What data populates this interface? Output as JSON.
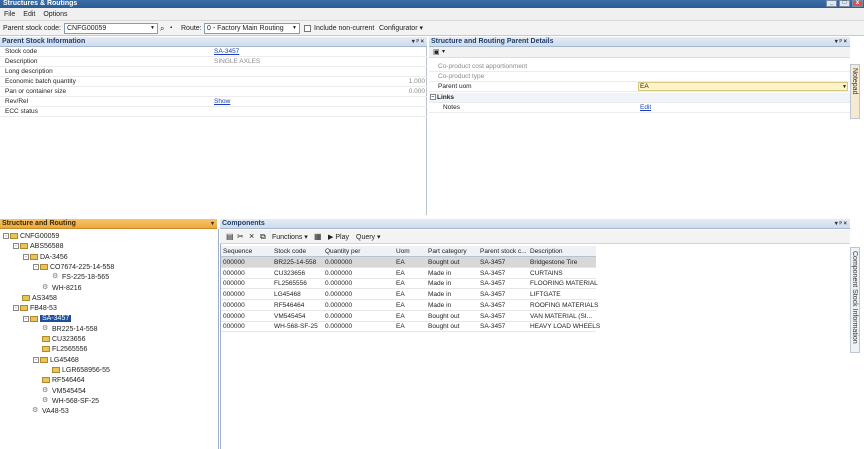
{
  "window": {
    "title": "Structures & Routings"
  },
  "menu": [
    "File",
    "Edit",
    "Options"
  ],
  "toolbar": {
    "parent_stock_label": "Parent stock code:",
    "parent_stock_value": "CNFG00059",
    "route_label": "Route:",
    "route_value": "0 - Factory Main Routing",
    "include_noncurrent_label": "Include non-current",
    "configurator_label": "Configurator"
  },
  "parent_stock": {
    "title": "Parent Stock Information",
    "rows": [
      {
        "label": "Stock code",
        "value": "SA-3457",
        "link": true
      },
      {
        "label": "Description",
        "value": "SINGLE AXLES",
        "link": false
      },
      {
        "label": "Long description",
        "value": "",
        "link": false
      },
      {
        "label": "Economic batch quantity",
        "value": "1.000",
        "link": false
      },
      {
        "label": "Pan or container size",
        "value": "0.000",
        "link": false
      },
      {
        "label": "Rev/Rel",
        "value": "Show",
        "link": true
      },
      {
        "label": "ECC status",
        "value": "",
        "link": false
      }
    ]
  },
  "routing_parent": {
    "title": "Structure and Routing Parent Details",
    "rows": [
      {
        "label": "Co-product cost apportionment",
        "value": ""
      },
      {
        "label": "Co-product type",
        "value": ""
      },
      {
        "label": "Parent uom",
        "value": "EA"
      }
    ],
    "links_section": "Links",
    "notes_label": "Notes",
    "notes_value": "Edit"
  },
  "tree": {
    "title": "Structure and Routing",
    "nodes": [
      {
        "label": "CNFG00059",
        "level": 0,
        "exp": "-",
        "icon": "folder-icon"
      },
      {
        "label": "ABS56588",
        "level": 1,
        "exp": "-",
        "icon": "folder-icon"
      },
      {
        "label": "DA-3456",
        "level": 2,
        "exp": "-",
        "icon": "folder-icon"
      },
      {
        "label": "CO7674-225-14-558",
        "level": 3,
        "exp": "-",
        "icon": "folder-icon"
      },
      {
        "label": "FS-225-18-565",
        "level": 4,
        "exp": "",
        "icon": "gear-icon"
      },
      {
        "label": "WH-8216",
        "level": 3,
        "exp": "",
        "icon": "gear-icon"
      },
      {
        "label": "AS3458",
        "level": 1,
        "exp": "",
        "icon": "folder-icon"
      },
      {
        "label": "FB48-53",
        "level": 1,
        "exp": "-",
        "icon": "folder-icon"
      },
      {
        "label": "SA-3457",
        "level": 2,
        "exp": "-",
        "icon": "folder-icon",
        "selected": true
      },
      {
        "label": "BR225-14-558",
        "level": 3,
        "exp": "",
        "icon": "gear-icon"
      },
      {
        "label": "CU323656",
        "level": 3,
        "exp": "",
        "icon": "folder-icon"
      },
      {
        "label": "FL2565556",
        "level": 3,
        "exp": "",
        "icon": "folder-icon"
      },
      {
        "label": "LG45468",
        "level": 3,
        "exp": "-",
        "icon": "folder-icon"
      },
      {
        "label": "LGR658956-55",
        "level": 4,
        "exp": "",
        "icon": "folder-icon"
      },
      {
        "label": "RF546464",
        "level": 3,
        "exp": "",
        "icon": "folder-icon"
      },
      {
        "label": "VM545454",
        "level": 3,
        "exp": "",
        "icon": "gear-icon"
      },
      {
        "label": "WH-568-SF-25",
        "level": 3,
        "exp": "",
        "icon": "gear-icon"
      },
      {
        "label": "VA48-53",
        "level": 2,
        "exp": "",
        "icon": "gear-icon"
      }
    ]
  },
  "components": {
    "title": "Components",
    "functions_label": "Functions",
    "play_label": "Play",
    "query_label": "Query",
    "columns": [
      "Sequence",
      "Stock code",
      "Quantity per",
      "Uom",
      "Part category",
      "Parent stock c...",
      "Description"
    ],
    "rows": [
      [
        "000000",
        "BR225-14-558",
        "0.000000",
        "EA",
        "Bought out",
        "SA-3457",
        "Bridgestone Tire"
      ],
      [
        "000000",
        "CU323656",
        "0.000000",
        "EA",
        "Made in",
        "SA-3457",
        "CURTAINS"
      ],
      [
        "000000",
        "FL2565556",
        "0.000000",
        "EA",
        "Made in",
        "SA-3457",
        "FLOORING MATERIAL"
      ],
      [
        "000000",
        "LG45468",
        "0.000000",
        "EA",
        "Made in",
        "SA-3457",
        "LIFTGATE"
      ],
      [
        "000000",
        "RF546464",
        "0.000000",
        "EA",
        "Made in",
        "SA-3457",
        "ROOFING MATERIALS"
      ],
      [
        "000000",
        "VM545454",
        "0.000000",
        "EA",
        "Bought out",
        "SA-3457",
        "VAN MATERIAL (SI..."
      ],
      [
        "000000",
        "WH-568-SF-25",
        "0.000000",
        "EA",
        "Bought out",
        "SA-3457",
        "HEAVY LOAD WHEELS"
      ]
    ]
  },
  "side_tabs": {
    "notepad": "Notepad",
    "component_stock": "Component Stock Information"
  }
}
